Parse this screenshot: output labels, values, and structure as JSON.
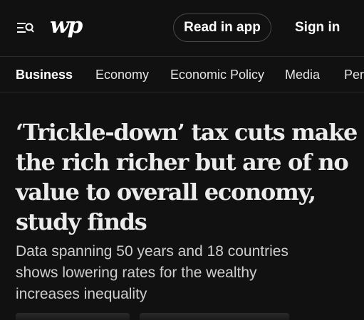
{
  "header": {
    "logo_text": "wp",
    "read_in_app_label": "Read in app",
    "sign_in_label": "Sign in"
  },
  "nav": {
    "items": [
      {
        "label": "Business",
        "active": true
      },
      {
        "label": "Economy",
        "active": false
      },
      {
        "label": "Economic Policy",
        "active": false
      },
      {
        "label": "Media",
        "active": false
      },
      {
        "label": "Pers",
        "active": false
      }
    ]
  },
  "article": {
    "headline_lines": [
      "‘Trickle-down’ tax cuts make",
      "the rich richer but are of no",
      "value to overall economy,",
      "study finds"
    ],
    "subheadline_lines": [
      "Data spanning 50 years and 18 countries",
      "shows lowering rates for the wealthy",
      "increases inequality"
    ]
  },
  "colors": {
    "background": "#111111",
    "text": "#ffffff",
    "divider": "#2b2b2b",
    "button_border": "#4a4a4a"
  },
  "icons": {
    "menu": "menu-search-icon"
  }
}
